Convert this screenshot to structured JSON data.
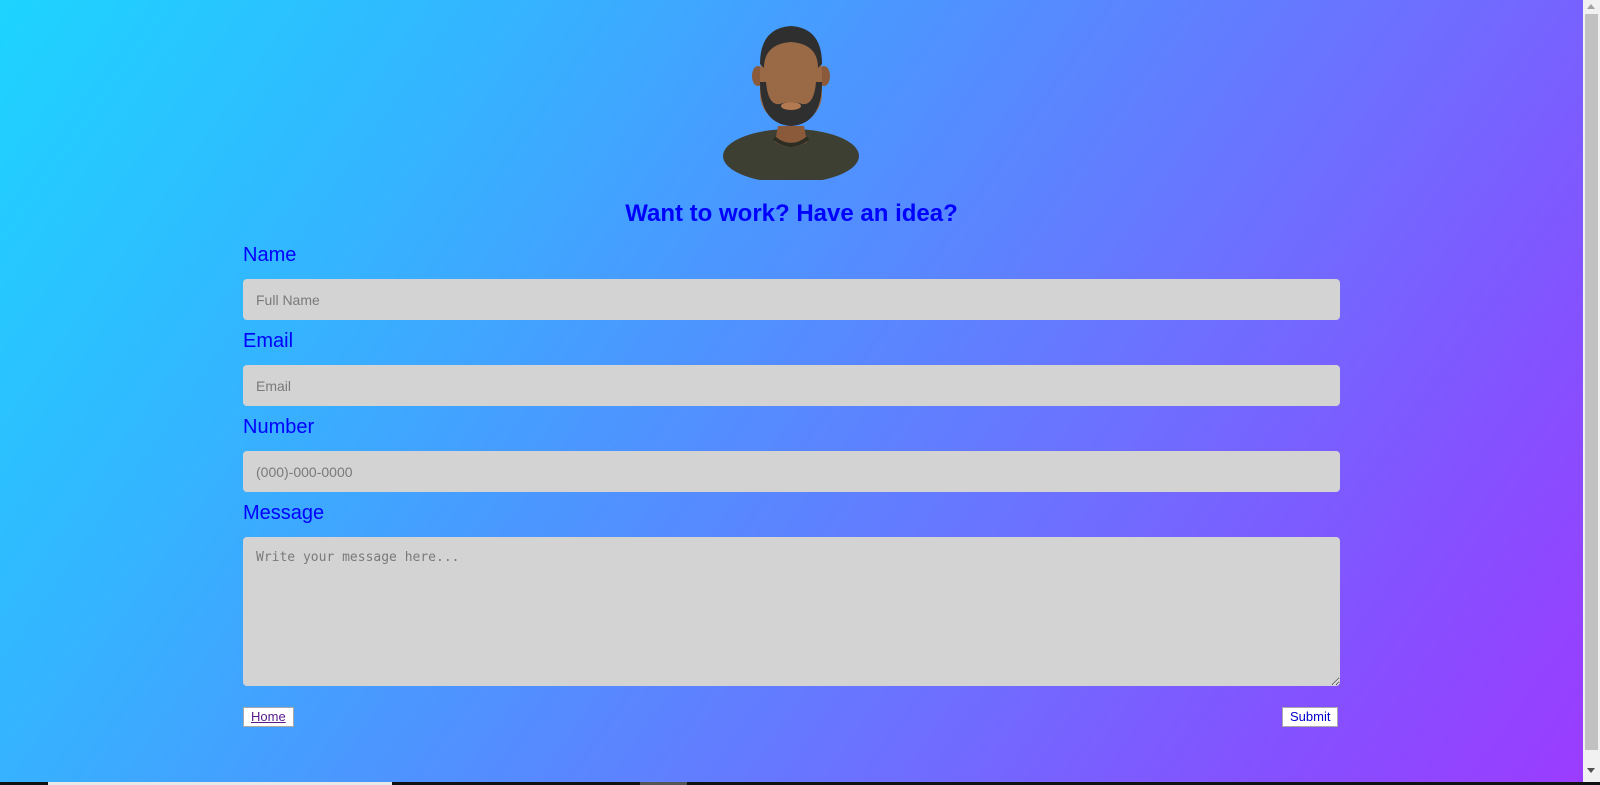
{
  "form": {
    "heading": "Want to work? Have an idea?",
    "name_label": "Name",
    "name_placeholder": "Full Name",
    "email_label": "Email",
    "email_placeholder": "Email",
    "number_label": "Number",
    "number_placeholder": "(000)-000-0000",
    "message_label": "Message",
    "message_placeholder": "Write your message here...",
    "home_label": "Home",
    "submit_label": "Submit"
  },
  "colors": {
    "background_gradient": [
      "#1dd4ff",
      "#9b3cff"
    ],
    "text_accent": "#0000ff",
    "field_background": "#d3d3d3"
  },
  "icons": {
    "avatar": "bearded-man-avatar"
  }
}
